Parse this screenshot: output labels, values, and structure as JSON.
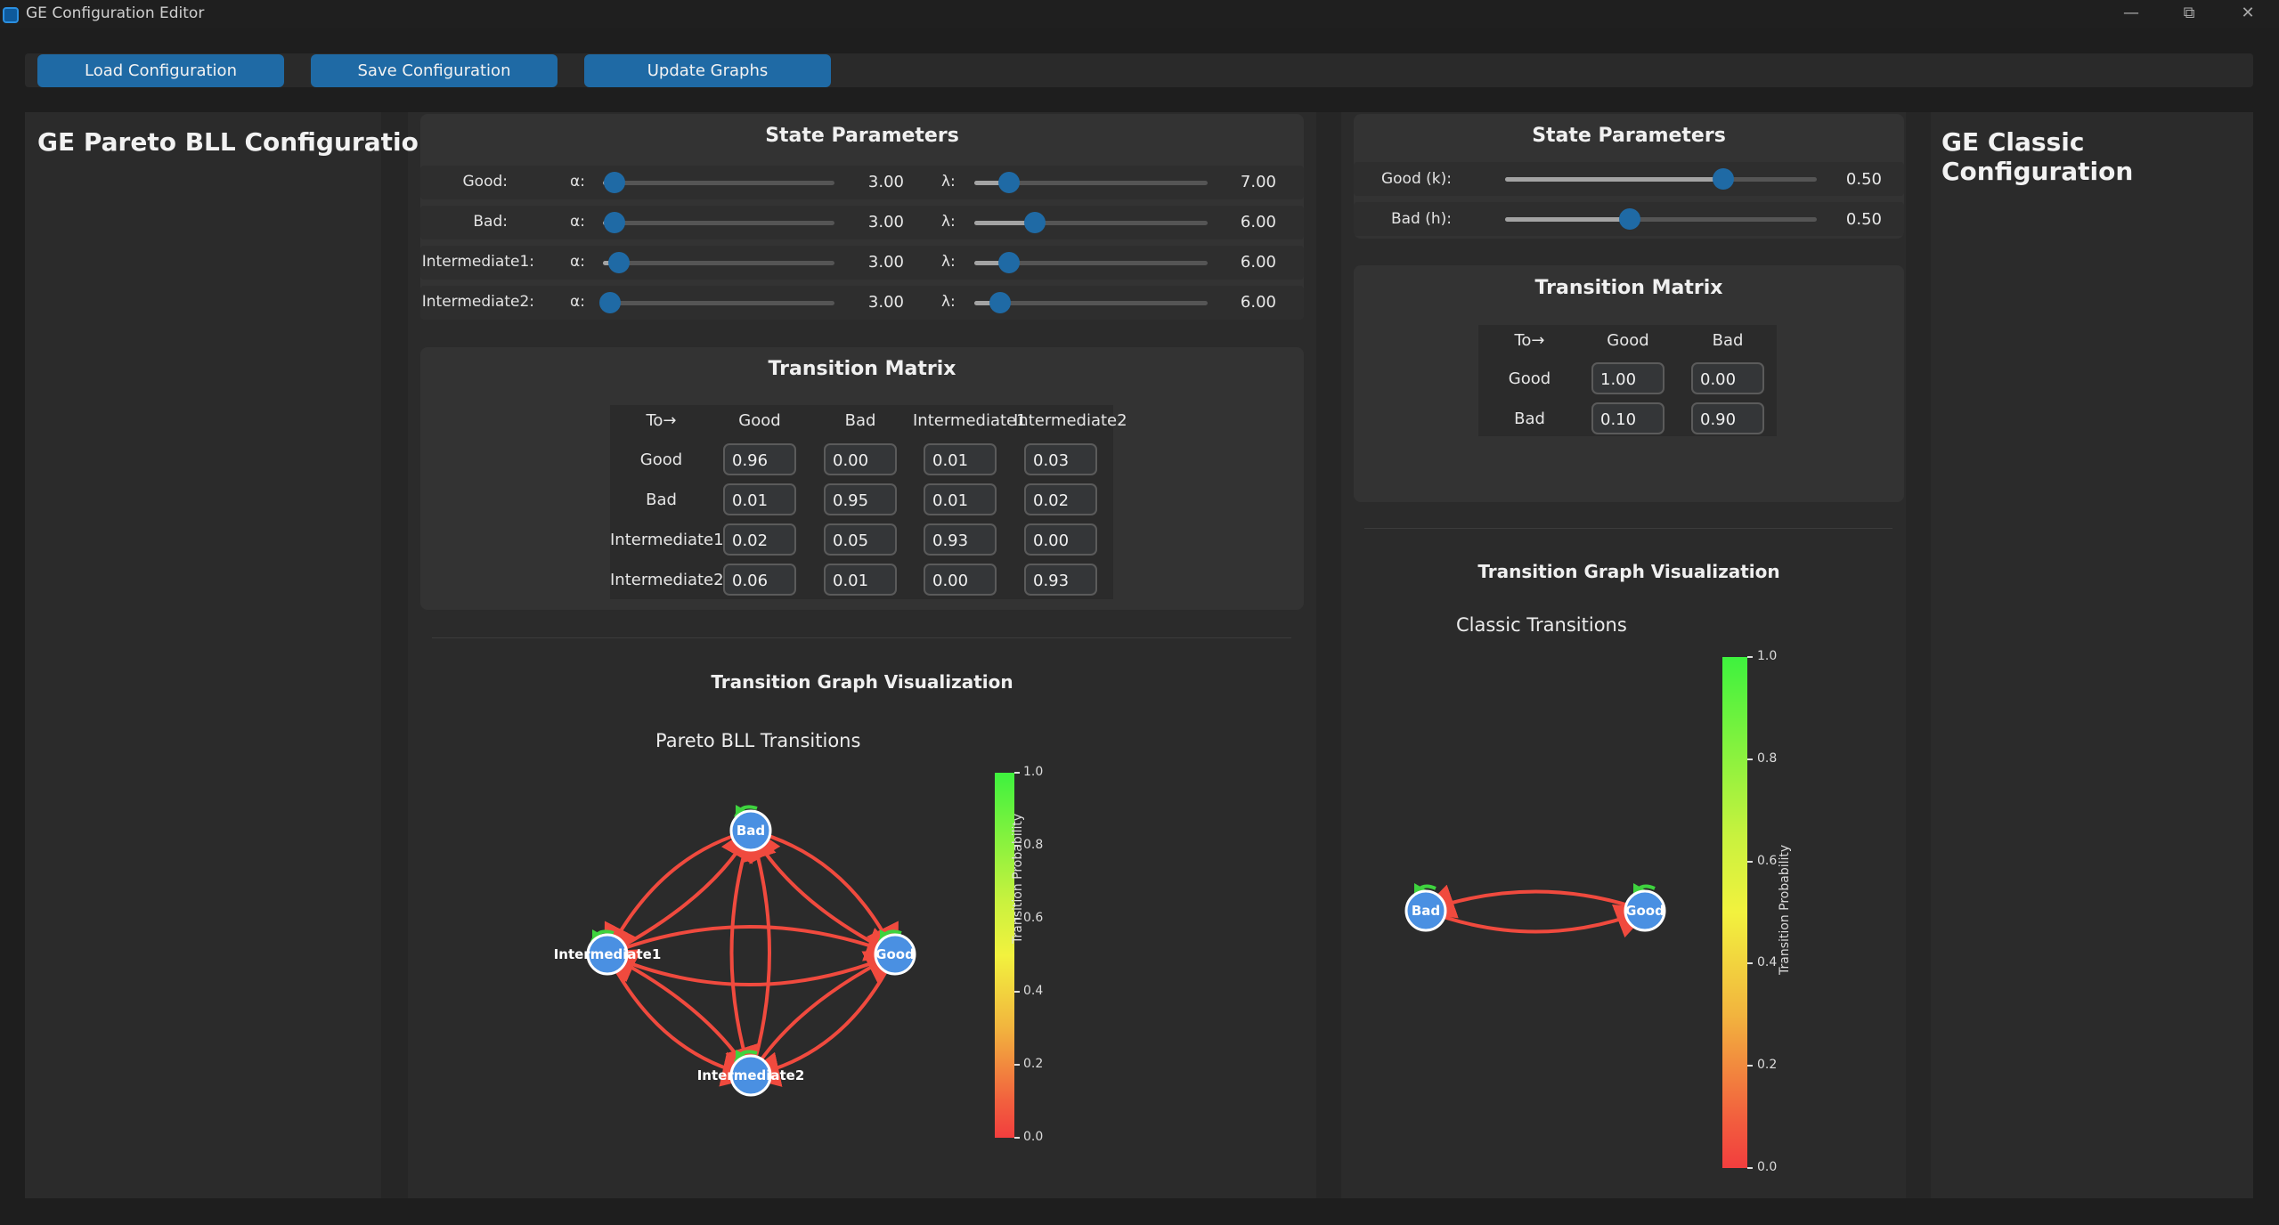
{
  "window": {
    "title": "GE Configuration Editor",
    "controls": [
      "—",
      "⧉",
      "✕"
    ]
  },
  "toolbar": {
    "load_label": "Load Configuration",
    "save_label": "Save Configuration",
    "update_label": "Update Graphs"
  },
  "colors": {
    "accent": "#1f6aa5",
    "node": "#4a90e2",
    "edge": "#f04a3e",
    "self_loop": "#3ed33e"
  },
  "pareto": {
    "title": "GE Pareto BLL Configuration",
    "state_params": {
      "title": "State Parameters",
      "rows": [
        {
          "label": "Good:",
          "alpha_symbol": "α:",
          "alpha": "3.00",
          "alpha_pos": 0.05,
          "lambda_symbol": "λ:",
          "lambda": "7.00",
          "lambda_pos": 0.15
        },
        {
          "label": "Bad:",
          "alpha_symbol": "α:",
          "alpha": "3.00",
          "alpha_pos": 0.05,
          "lambda_symbol": "λ:",
          "lambda": "6.00",
          "lambda_pos": 0.26
        },
        {
          "label": "Intermediate1:",
          "alpha_symbol": "α:",
          "alpha": "3.00",
          "alpha_pos": 0.07,
          "lambda_symbol": "λ:",
          "lambda": "6.00",
          "lambda_pos": 0.15
        },
        {
          "label": "Intermediate2:",
          "alpha_symbol": "α:",
          "alpha": "3.00",
          "alpha_pos": 0.03,
          "lambda_symbol": "λ:",
          "lambda": "6.00",
          "lambda_pos": 0.11
        }
      ]
    },
    "matrix": {
      "title": "Transition Matrix",
      "corner": "To→",
      "columns": [
        "Good",
        "Bad",
        "Intermediate1",
        "Intermediate2"
      ],
      "rows": [
        {
          "label": "Good",
          "values": [
            "0.96",
            "0.00",
            "0.01",
            "0.03"
          ]
        },
        {
          "label": "Bad",
          "values": [
            "0.01",
            "0.95",
            "0.01",
            "0.02"
          ]
        },
        {
          "label": "Intermediate1",
          "values": [
            "0.02",
            "0.05",
            "0.93",
            "0.00"
          ]
        },
        {
          "label": "Intermediate2",
          "values": [
            "0.06",
            "0.01",
            "0.00",
            "0.93"
          ]
        }
      ]
    },
    "graph": {
      "section_title": "Transition Graph Visualization",
      "plot_title": "Pareto BLL Transitions",
      "nodes": [
        "Bad",
        "Good",
        "Intermediate1",
        "Intermediate2"
      ],
      "colorbar_label": "Transition Probability",
      "colorbar_ticks": [
        "1.0",
        "0.8",
        "0.6",
        "0.4",
        "0.2",
        "0.0"
      ]
    }
  },
  "classic": {
    "title": "GE Classic Configuration",
    "state_params": {
      "title": "State Parameters",
      "rows": [
        {
          "label": "Good (k):",
          "value": "0.50",
          "pos": 0.7
        },
        {
          "label": "Bad (h):",
          "value": "0.50",
          "pos": 0.4
        }
      ]
    },
    "matrix": {
      "title": "Transition Matrix",
      "corner": "To→",
      "columns": [
        "Good",
        "Bad"
      ],
      "rows": [
        {
          "label": "Good",
          "values": [
            "1.00",
            "0.00"
          ]
        },
        {
          "label": "Bad",
          "values": [
            "0.10",
            "0.90"
          ]
        }
      ]
    },
    "graph": {
      "section_title": "Transition Graph Visualization",
      "plot_title": "Classic Transitions",
      "nodes": [
        "Bad",
        "Good"
      ],
      "colorbar_label": "Transition Probability",
      "colorbar_ticks": [
        "1.0",
        "0.8",
        "0.6",
        "0.4",
        "0.2",
        "0.0"
      ]
    }
  }
}
